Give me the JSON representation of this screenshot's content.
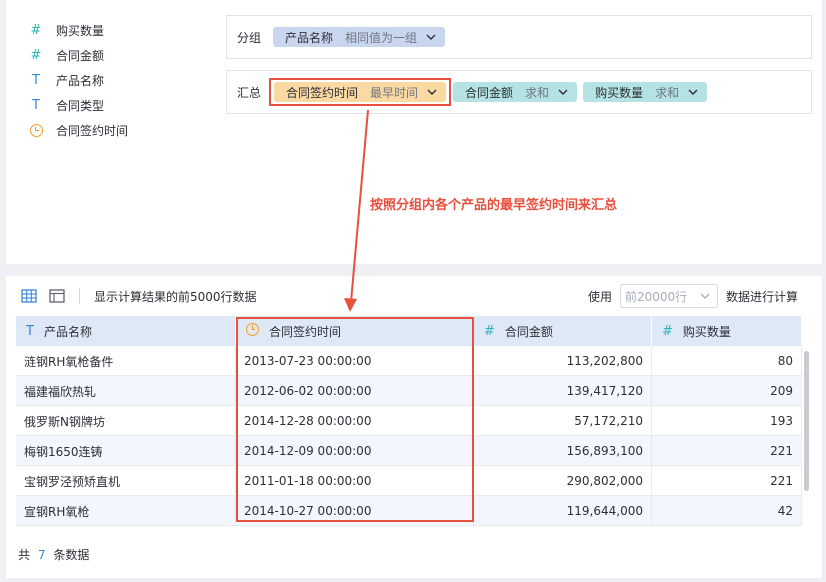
{
  "fields": [
    {
      "icon": "number-icon",
      "type": "num",
      "label": "购买数量"
    },
    {
      "icon": "number-icon",
      "type": "num",
      "label": "合同金额"
    },
    {
      "icon": "text-icon",
      "type": "txt",
      "label": "产品名称"
    },
    {
      "icon": "text-icon",
      "type": "txt",
      "label": "合同类型"
    },
    {
      "icon": "clock-icon",
      "type": "date",
      "label": "合同签约时间"
    }
  ],
  "group": {
    "label": "分组",
    "chip": {
      "name": "产品名称",
      "agg": "相同值为一组"
    }
  },
  "summary": {
    "label": "汇总",
    "chips": [
      {
        "name": "合同签约时间",
        "agg": "最早时间"
      },
      {
        "name": "合同金额",
        "agg": "求和"
      },
      {
        "name": "购买数量",
        "agg": "求和"
      }
    ]
  },
  "annotation": "按照分组内各个产品的最早签约时间来汇总",
  "toolbar": {
    "preview_text": "显示计算结果的前5000行数据",
    "use_label": "使用",
    "limit_placeholder": "前20000行",
    "calc_label": "数据进行计算"
  },
  "table": {
    "headers": [
      {
        "icon": "T",
        "label": "产品名称"
      },
      {
        "icon": "clock",
        "label": "合同签约时间"
      },
      {
        "icon": "#",
        "label": "合同金额"
      },
      {
        "icon": "#",
        "label": "购买数量"
      }
    ],
    "rows": [
      [
        "涟钢RH氧枪备件",
        "2013-07-23 00:00:00",
        "113,202,800",
        "80"
      ],
      [
        "福建福欣热轧",
        "2012-06-02 00:00:00",
        "139,417,120",
        "209"
      ],
      [
        "俄罗斯N钢牌坊",
        "2014-12-28 00:00:00",
        "57,172,210",
        "193"
      ],
      [
        "梅钢1650连铸",
        "2014-12-09 00:00:00",
        "156,893,100",
        "221"
      ],
      [
        "宝钢罗泾预矫直机",
        "2011-01-18 00:00:00",
        "290,802,000",
        "221"
      ],
      [
        "宣钢RH氧枪",
        "2014-10-27 00:00:00",
        "119,644,000",
        "42"
      ]
    ]
  },
  "footer": {
    "prefix": "共",
    "count": "7",
    "suffix": "条数据"
  },
  "colors": {
    "highlight": "#e8503e",
    "header_bg": "#dfe8f7",
    "accent": "#3b86d6"
  }
}
